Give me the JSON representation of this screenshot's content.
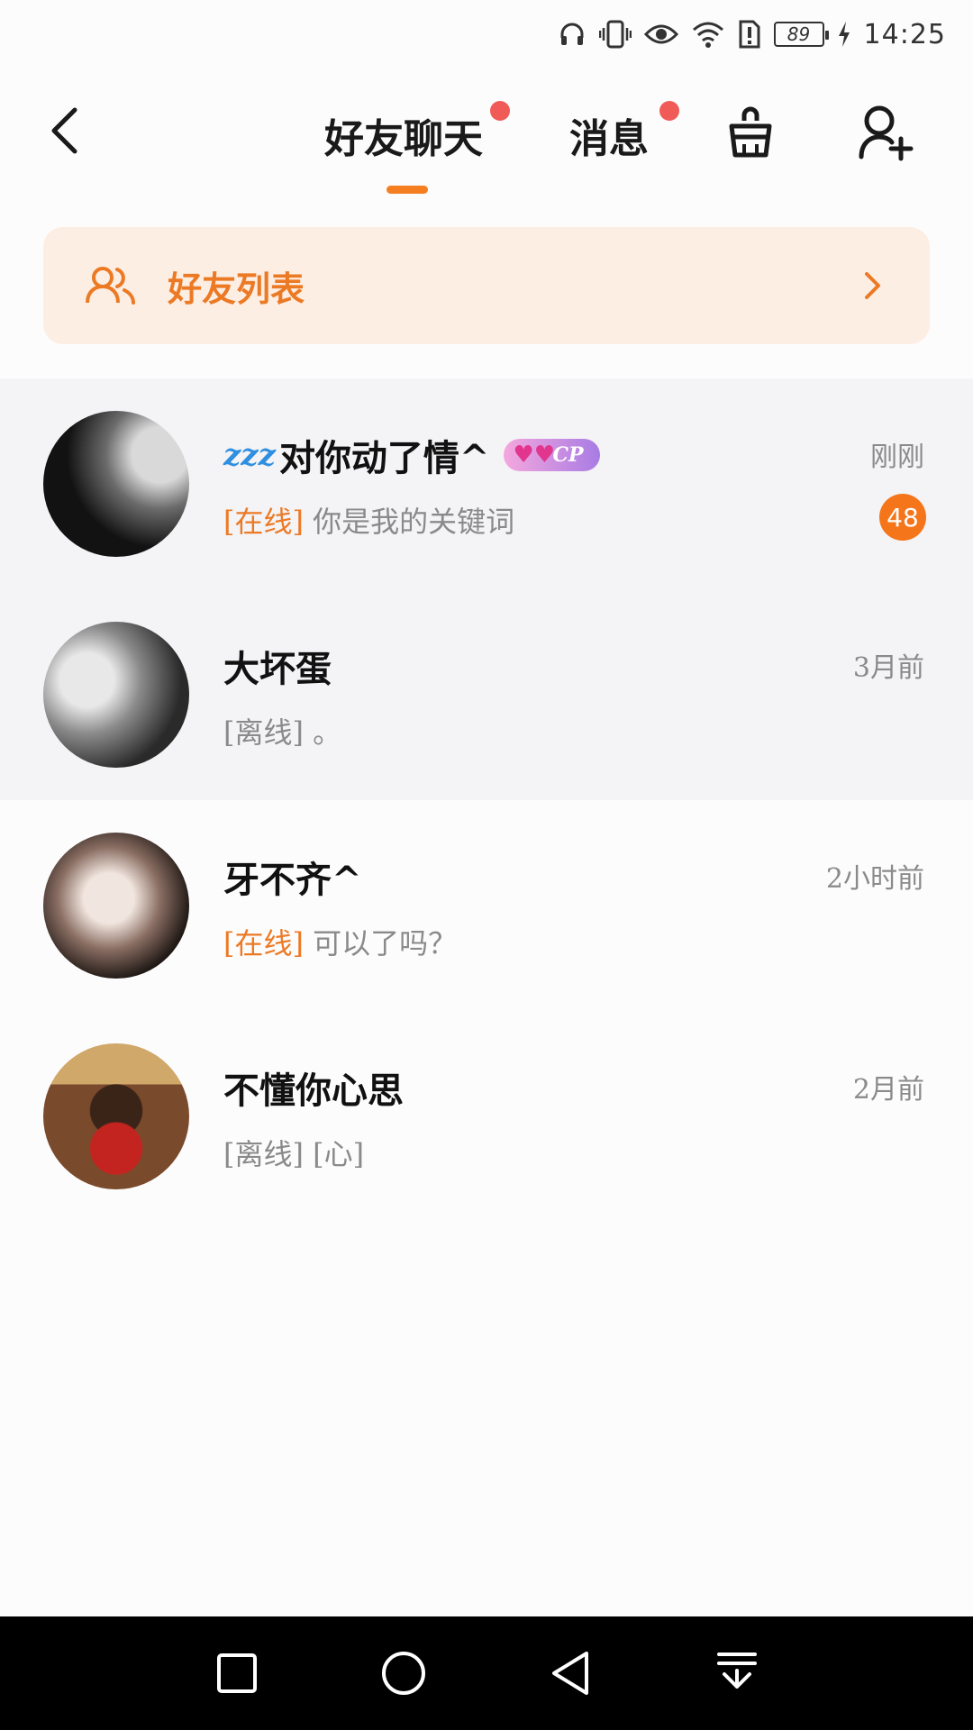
{
  "status_bar": {
    "battery_level": "89",
    "time": "14:25",
    "icons": [
      "headphones-icon",
      "vibrate-icon",
      "eye-icon",
      "wifi-icon",
      "sim-alert-icon",
      "battery-icon",
      "charging-icon"
    ]
  },
  "header": {
    "tabs": [
      {
        "label": "好友聊天",
        "active": true,
        "has_dot": true
      },
      {
        "label": "消息",
        "active": false,
        "has_dot": true
      }
    ],
    "accent_color": "#f57e20",
    "dot_color": "#f05a57"
  },
  "friends_banner": {
    "label": "好友列表"
  },
  "chats": [
    {
      "name": "对你动了情^",
      "prefix_icon": "zzz",
      "badge": "CP",
      "time": "刚刚",
      "status": "[在线]",
      "preview": "你是我的关键词",
      "unread": "48",
      "pinned": true
    },
    {
      "name": "大坏蛋",
      "time": "3月前",
      "status": "[离线]",
      "preview": "。",
      "pinned": true
    },
    {
      "name": "牙不齐^",
      "time": "2小时前",
      "status": "[在线]",
      "preview": "可以了吗？",
      "pinned": false
    },
    {
      "name": "不懂你心思",
      "time": "2月前",
      "status": "[离线]",
      "preview": "[心]",
      "pinned": false
    }
  ]
}
